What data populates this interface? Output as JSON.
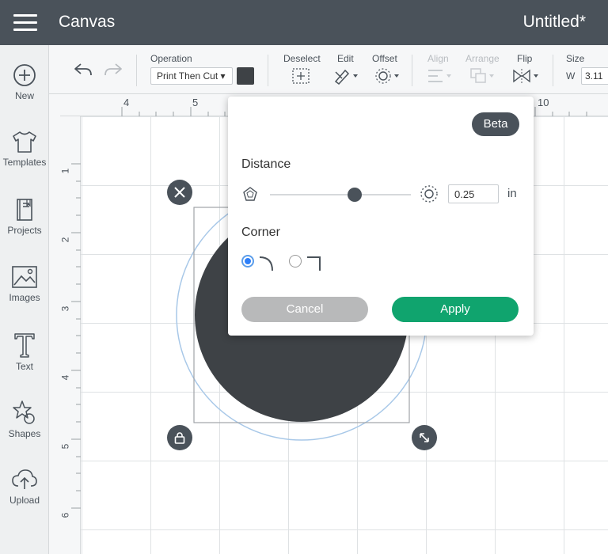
{
  "header": {
    "app_title": "Canvas",
    "document_title": "Untitled*"
  },
  "sidebar": {
    "items": [
      {
        "label": "New",
        "icon": "plus-circle-icon"
      },
      {
        "label": "Templates",
        "icon": "shirt-icon"
      },
      {
        "label": "Projects",
        "icon": "book-icon"
      },
      {
        "label": "Images",
        "icon": "image-icon"
      },
      {
        "label": "Text",
        "icon": "text-icon"
      },
      {
        "label": "Shapes",
        "icon": "shapes-icon"
      },
      {
        "label": "Upload",
        "icon": "upload-icon"
      }
    ]
  },
  "toolbar": {
    "operation_label": "Operation",
    "operation_value": "Print Then Cut",
    "operation_color": "#3e4246",
    "deselect_label": "Deselect",
    "edit_label": "Edit",
    "offset_label": "Offset",
    "align_label": "Align",
    "arrange_label": "Arrange",
    "flip_label": "Flip",
    "size_label": "Size",
    "size_w_label": "W",
    "size_w_value": "3.11"
  },
  "rulers": {
    "top": [
      "4",
      "5",
      "10"
    ],
    "left": [
      "1",
      "2",
      "3",
      "4",
      "5",
      "6"
    ]
  },
  "offset_panel": {
    "badge": "Beta",
    "distance_heading": "Distance",
    "distance_value": "0.25",
    "distance_unit": "in",
    "distance_slider_fraction": 0.6,
    "corner_heading": "Corner",
    "corner_selected": "rounded",
    "cancel_label": "Cancel",
    "apply_label": "Apply"
  },
  "colors": {
    "header": "#4a525a",
    "apply": "#10a46e",
    "cancel": "#b8b9ba",
    "shape_fill": "#3e4246",
    "offset_outline": "#a8c8e8",
    "radio_active": "#2d7ff9"
  }
}
